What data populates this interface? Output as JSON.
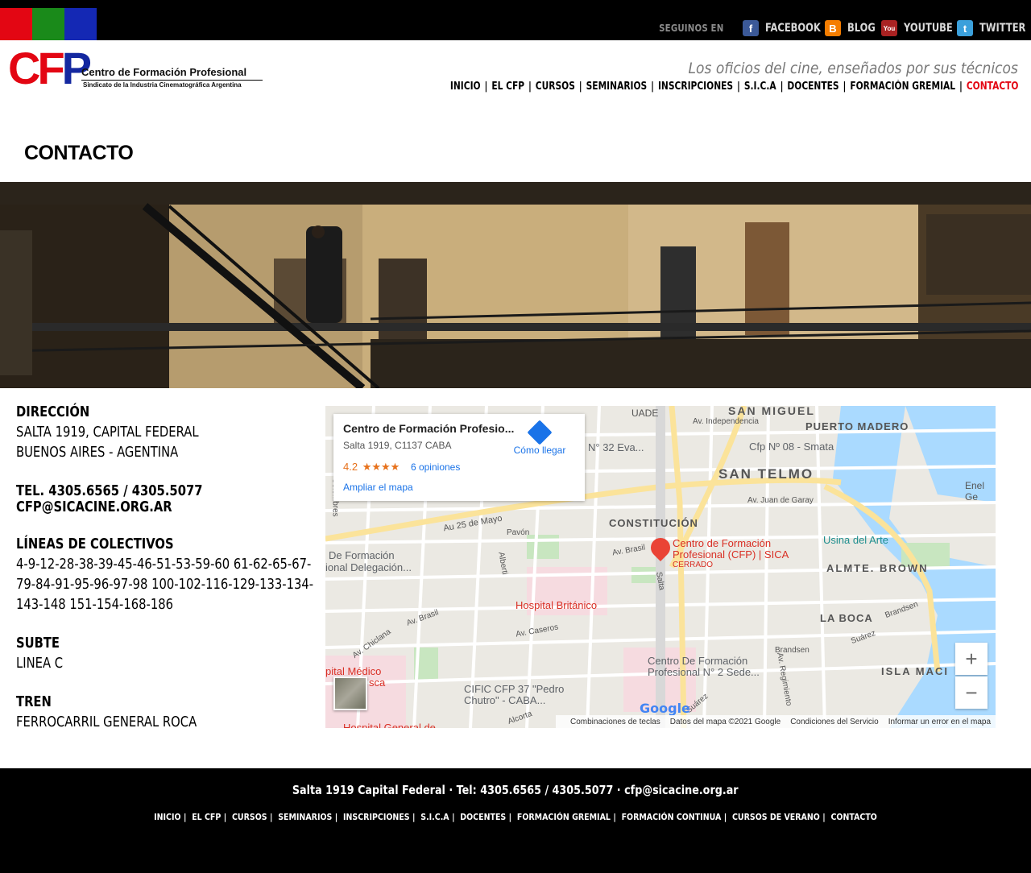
{
  "topbar": {
    "colors": [
      "#e30613",
      "#1a8a1a",
      "#1428b4"
    ],
    "follow_label": "SEGUINOS EN",
    "networks": [
      {
        "label": "FACEBOOK",
        "icon": "facebook-icon",
        "glyph": "f"
      },
      {
        "label": "BLOG",
        "icon": "blogger-icon",
        "glyph": "B"
      },
      {
        "label": "YOUTUBE",
        "icon": "youtube-icon",
        "glyph": "You"
      },
      {
        "label": "TWITTER",
        "icon": "twitter-icon",
        "glyph": "t"
      }
    ]
  },
  "header": {
    "logo_letters": [
      "C",
      "F",
      "P"
    ],
    "logo_name": "Centro de Formación Profesional",
    "logo_sub": "Sindicato de la Industria Cinematográfica Argentina",
    "tagline": "Los oficios del cine, enseñados por sus técnicos",
    "nav": [
      "INICIO",
      "EL CFP",
      "CURSOS",
      "SEMINARIOS",
      "INSCRIPCIONES",
      "S.I.C.A",
      "DOCENTES",
      "FORMACIÓN GREMIAL",
      "CONTACTO"
    ],
    "nav_active": "CONTACTO"
  },
  "page_title": "CONTACTO",
  "info": {
    "address_heading": "DIRECCIÓN",
    "address_lines": [
      "SALTA 1919, CAPITAL FEDERAL",
      "BUENOS AIRES - AGENTINA"
    ],
    "phone": "TEL. 4305.6565 / 4305.5077",
    "email": "CFP@SICACINE.ORG.AR",
    "bus_heading": "LÍNEAS DE COLECTIVOS",
    "bus_lines": [
      "4-9-12-28-38-39-45-46-51-53-59-60 61-62-65-67-",
      "79-84-91-95-96-97-98 100-102-116-129-133-134-",
      "143-148 151-154-168-186"
    ],
    "subte_heading": "SUBTE",
    "subte": "LINEA C",
    "tren_heading": "TREN",
    "tren": "FERROCARRIL GENERAL ROCA"
  },
  "map": {
    "card_name": "Centro de Formación Profesio...",
    "card_address": "Salta 1919, C1137 CABA",
    "rating": "4.2",
    "stars": "★★★★",
    "reviews": "6 opiniones",
    "enlarge": "Ampliar el mapa",
    "directions": "Cómo llegar",
    "zoom_in": "+",
    "zoom_out": "−",
    "google": "Google",
    "attribution": [
      "Combinaciones de teclas",
      "Datos del mapa ©2021 Google",
      "Condiciones del Servicio",
      "Informar un error en el mapa"
    ],
    "labels": {
      "san_miguel": "SAN MIGUEL",
      "puerto_madero": "PUERTO MADERO",
      "san_telmo": "SAN TELMO",
      "constitucion": "CONSTITUCIÓN",
      "almte_brown": "ALMTE. BROWN",
      "la_boca": "LA BOCA",
      "isla_maciel": "ISLA MACI",
      "uade": "UADE",
      "av_independencia": "Av. Independencia",
      "cfp08": "Cfp Nº 08 - Smata",
      "cfp32": "N° 32 Eva...",
      "enel": "Enel Ge",
      "av_juan_garay": "Av. Juan de Garay",
      "au25": "Au 25 de Mayo",
      "pavon": "Pavón",
      "colombres": "Colombres",
      "alberti": "Alberti",
      "av_brasil": "Av. Brasil",
      "av_brasil2": "Av. Brasil",
      "salta": "Salta",
      "usina": "Usina del Arte",
      "place_name_1": "Centro de Formación",
      "place_name_2": "Profesional (CFP) | SICA",
      "place_status": "CERRADO",
      "deleg_1": "De Formación",
      "deleg_2": "ional Delegación...",
      "hospital_britanico": "Hospital Británico",
      "av_caseros": "Av. Caseros",
      "av_chiclana": "Av. Chiclana",
      "cfp2_1": "Centro De Formación",
      "cfp2_2": "Profesional N° 2 Sede...",
      "cific_1": "CIFIC CFP 37 \"Pedro",
      "cific_2": "Chutro\" - CABA...",
      "hosp_medico": "pital Médico",
      "hosp_medico2": "sca",
      "brandsen": "Brandsen",
      "brandsen2": "Brandsen",
      "suarez": "Suárez",
      "suarez2": "Suárez",
      "av_regimiento": "Av. Regimiento",
      "alcorta": "Alcorta",
      "hosp_general": "Hospital General de"
    }
  },
  "footer": {
    "contact": "Salta 1919 Capital Federal · Tel: 4305.6565 / 4305.5077 · cfp@sicacine.org.ar",
    "nav": [
      "INICIO",
      "EL CFP",
      "CURSOS",
      "SEMINARIOS",
      "INSCRIPCIONES",
      "S.I.C.A",
      "DOCENTES",
      "FORMACIÓN GREMIAL",
      "FORMACIÓN CONTINUA",
      "CURSOS DE VERANO",
      "CONTACTO"
    ]
  }
}
